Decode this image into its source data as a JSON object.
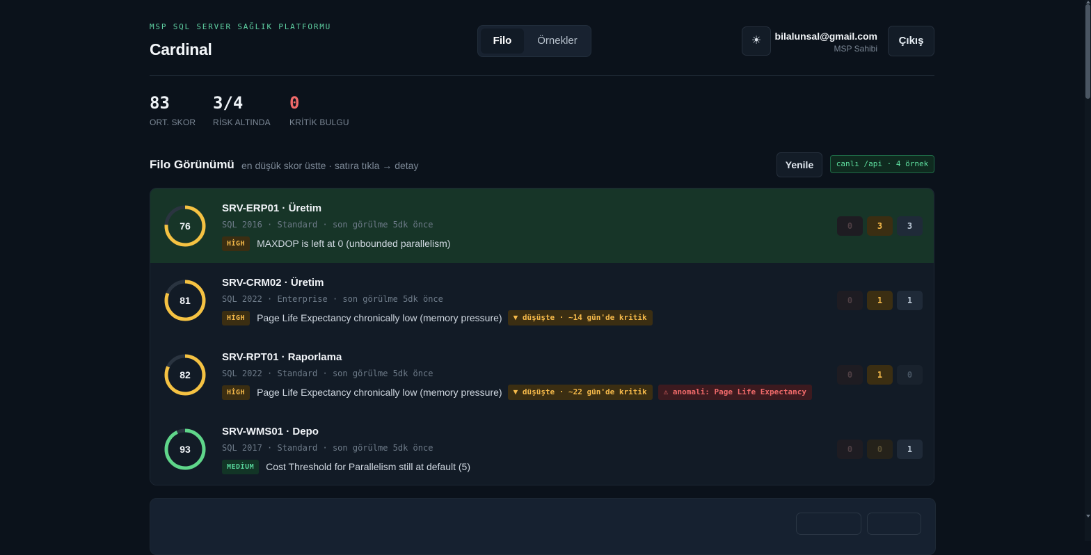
{
  "header": {
    "kicker": "MSP SQL SERVER SAĞLIK PLATFORMU",
    "brand": "Cardinal",
    "tabs": [
      {
        "label": "Filo",
        "active": true
      },
      {
        "label": "Örnekler",
        "active": false
      }
    ],
    "theme_icon": "☀",
    "user_email": "bilalunsal@gmail.com",
    "user_role": "MSP Sahibi",
    "logout_label": "Çıkış"
  },
  "stats": [
    {
      "value": "83",
      "label": "ORT. SKOR"
    },
    {
      "value": "3/4",
      "label": "RİSK ALTINDA"
    },
    {
      "value": "0",
      "label": "KRİTİK BULGU"
    }
  ],
  "section": {
    "title": "Filo Görünümü",
    "subtitle": "en düşük skor üstte · satıra tıkla → detay",
    "refresh_label": "Yenile",
    "live_badge": "canlı /api · 4 örnek"
  },
  "colors": {
    "score_warn": "#f5c242",
    "score_good": "#5fd68a",
    "track": "#2a3440",
    "selected_row": "#173528"
  },
  "servers": [
    {
      "name": "SRV-ERP01 · Üretim",
      "meta": "SQL 2016 · Standard · son görülme 5dk önce",
      "score": 76,
      "severity": "HİGH",
      "finding": "MAXDOP is left at 0 (unbounded parallelism)",
      "trend": "",
      "anomaly": "",
      "counts": {
        "critical": "0",
        "high": "3",
        "medium": "3"
      }
    },
    {
      "name": "SRV-CRM02 · Üretim",
      "meta": "SQL 2022 · Enterprise · son görülme 5dk önce",
      "score": 81,
      "severity": "HİGH",
      "finding": "Page Life Expectancy chronically low (memory pressure)",
      "trend": "▼ düşüşte · ~14 gün'de kritik",
      "anomaly": "",
      "counts": {
        "critical": "0",
        "high": "1",
        "medium": "1"
      }
    },
    {
      "name": "SRV-RPT01 · Raporlama",
      "meta": "SQL 2022 · Standard · son görülme 5dk önce",
      "score": 82,
      "severity": "HİGH",
      "finding": "Page Life Expectancy chronically low (memory pressure)",
      "trend": "▼ düşüşte · ~22 gün'de kritik",
      "anomaly": "⚠ anomali: Page Life Expectancy",
      "counts": {
        "critical": "0",
        "high": "1",
        "medium": "0"
      }
    },
    {
      "name": "SRV-WMS01 · Depo",
      "meta": "SQL 2017 · Standard · son görülme 5dk önce",
      "score": 93,
      "severity": "MEDİUM",
      "finding": "Cost Threshold for Parallelism still at default (5)",
      "trend": "",
      "anomaly": "",
      "counts": {
        "critical": "0",
        "high": "0",
        "medium": "1"
      }
    }
  ]
}
